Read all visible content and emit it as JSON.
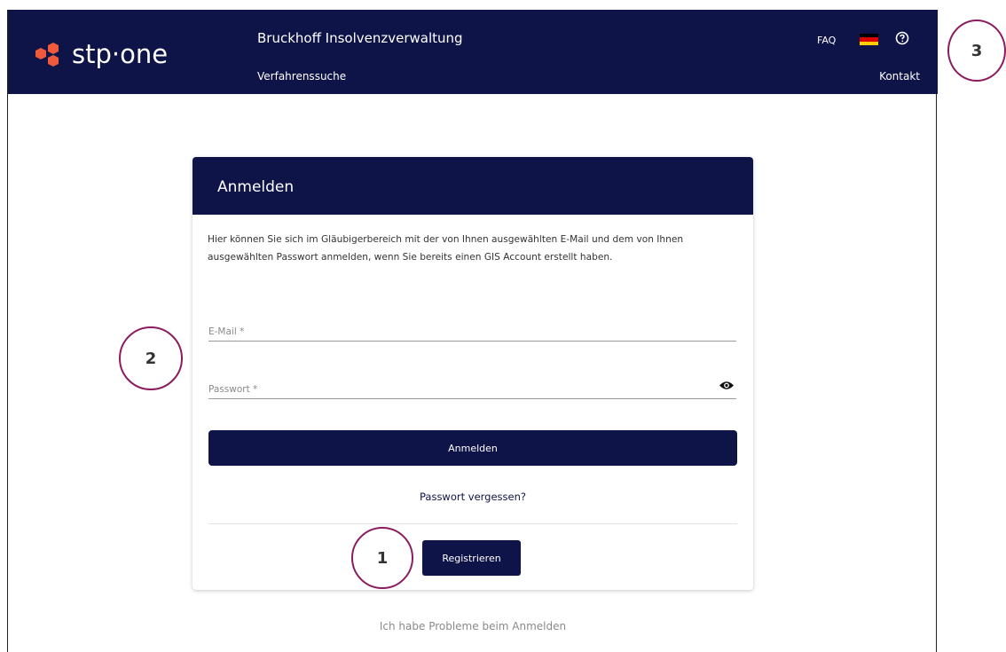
{
  "header": {
    "logo_text": "stp·one",
    "org_title": "Bruckhoff Insolvenzverwaltung",
    "nav_link": "Verfahrenssuche",
    "faq_label": "FAQ",
    "language_icon": "german-flag-icon",
    "help_icon": "help-circle-icon",
    "contact_label": "Kontakt"
  },
  "login": {
    "title": "Anmelden",
    "intro": "Hier können Sie sich im Gläubigerbereich mit der von Ihnen ausgewählten E-Mail und dem von Ihnen ausgewählten Passwort anmelden, wenn Sie bereits einen GIS Account erstellt haben.",
    "email": {
      "placeholder": "E-Mail *",
      "value": ""
    },
    "password": {
      "placeholder": "Passwort *",
      "value": "",
      "toggle_icon": "eye-icon"
    },
    "submit_label": "Anmelden",
    "forgot_label": "Passwort vergessen?",
    "register_label": "Registrieren"
  },
  "problems_label": "Ich habe Probleme beim Anmelden",
  "markers": [
    "1",
    "2",
    "3"
  ],
  "colors": {
    "navy": "#0e1448",
    "logo_orange": "#ef5a3c",
    "marker_border": "#8b1c5e"
  }
}
